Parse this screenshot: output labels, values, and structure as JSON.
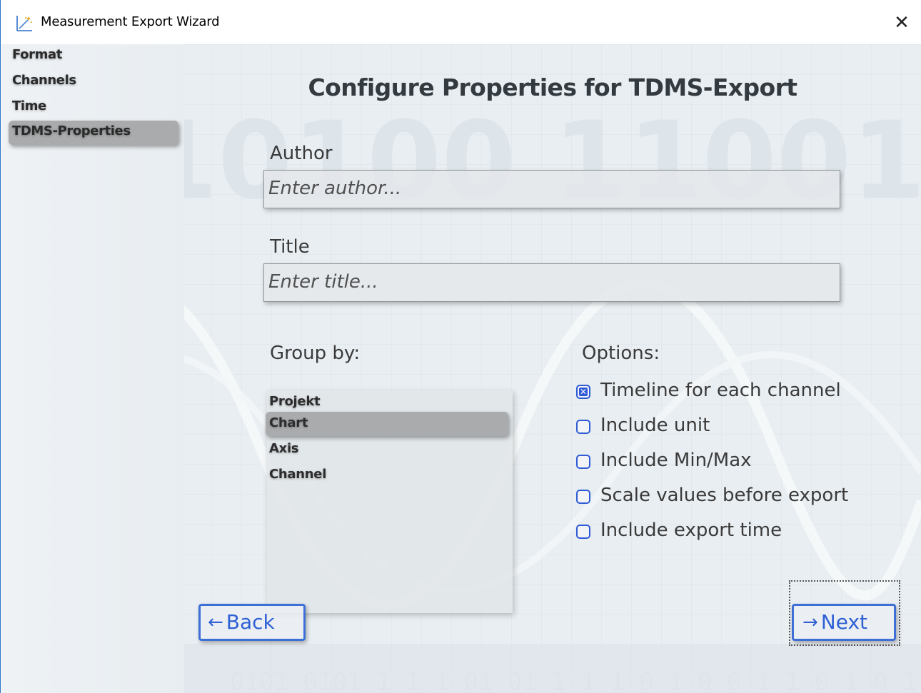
{
  "window": {
    "title": "Measurement Export Wizard",
    "close_glyph": "✕",
    "app_icon": "chart-wand-icon"
  },
  "sidebar": {
    "items": [
      {
        "label": "Format",
        "active": false
      },
      {
        "label": "Channels",
        "active": false
      },
      {
        "label": "Time",
        "active": false
      },
      {
        "label": "TDMS-Properties",
        "active": true
      }
    ]
  },
  "main": {
    "title": "Configure Properties for TDMS-Export",
    "author": {
      "label": "Author",
      "value": "",
      "placeholder": "Enter author..."
    },
    "title_field": {
      "label": "Title",
      "value": "",
      "placeholder": "Enter title..."
    },
    "group_by": {
      "label": "Group by:",
      "items": [
        {
          "label": "Projekt",
          "selected": false
        },
        {
          "label": "Chart",
          "selected": true
        },
        {
          "label": "Axis",
          "selected": false
        },
        {
          "label": "Channel",
          "selected": false
        }
      ]
    },
    "options": {
      "label": "Options:",
      "items": [
        {
          "label": "Timeline for each channel",
          "checked": true
        },
        {
          "label": "Include unit",
          "checked": false
        },
        {
          "label": "Include Min/Max",
          "checked": false
        },
        {
          "label": "Scale values before export",
          "checked": false
        },
        {
          "label": "Include export time",
          "checked": false
        }
      ]
    }
  },
  "footer": {
    "back_label": "Back",
    "next_label": "Next",
    "back_arrow": "←",
    "next_arrow": "→"
  },
  "colors": {
    "accent": "#2f5bd6",
    "selection": "#a9abad",
    "background": "#e9eef2",
    "window_border": "#2b73c8"
  }
}
